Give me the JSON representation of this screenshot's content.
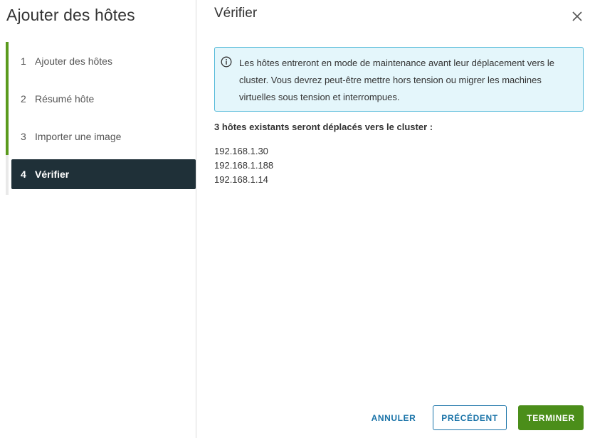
{
  "wizard": {
    "title": "Ajouter des hôtes",
    "steps": [
      {
        "number": "1",
        "label": "Ajouter des hôtes",
        "state": "done"
      },
      {
        "number": "2",
        "label": "Résumé hôte",
        "state": "done"
      },
      {
        "number": "3",
        "label": "Importer une image",
        "state": "done"
      },
      {
        "number": "4",
        "label": "Vérifier",
        "state": "current"
      }
    ]
  },
  "main": {
    "title": "Vérifier",
    "alert": {
      "icon": "info-icon",
      "text": "Les hôtes entreront en mode de maintenance avant leur déplacement vers le cluster. Vous devrez peut-être mettre hors tension ou migrer les machines virtuelles sous tension et interrompues."
    },
    "hosts_heading": "3 hôtes existants seront déplacés vers le cluster :",
    "hosts": [
      "192.168.1.30",
      "192.168.1.188",
      "192.168.1.14"
    ]
  },
  "footer": {
    "cancel_label": "ANNULER",
    "previous_label": "PRÉCÉDENT",
    "finish_label": "TERMINER"
  },
  "colors": {
    "step_done_bar": "#5a9a1d",
    "current_step_bg": "#1f3038",
    "alert_bg": "#e4f6fb",
    "alert_border": "#53b9d9",
    "link_blue": "#1a73a8",
    "primary_green": "#4b8e1a"
  }
}
